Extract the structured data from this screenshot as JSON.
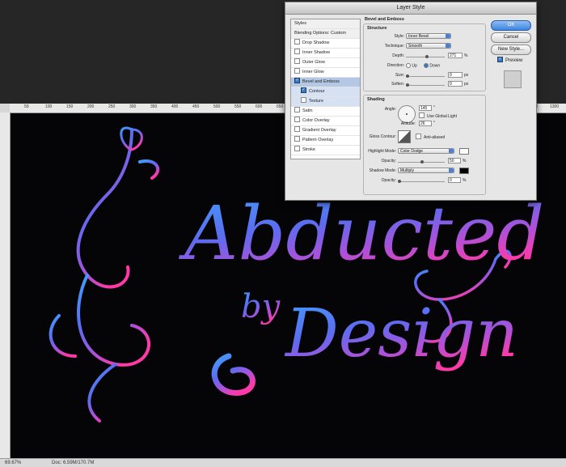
{
  "dialog": {
    "title": "Layer Style",
    "buttons": {
      "ok": "OK",
      "cancel": "Cancel",
      "new_style": "New Style...",
      "preview": "Preview"
    },
    "styles_list": [
      {
        "label": "Styles",
        "checkbox": false,
        "header": true
      },
      {
        "label": "Blending Options: Custom",
        "checkbox": false,
        "header": true
      },
      {
        "label": "Drop Shadow",
        "checkbox": true,
        "checked": false
      },
      {
        "label": "Inner Shadow",
        "checkbox": true,
        "checked": false
      },
      {
        "label": "Outer Glow",
        "checkbox": true,
        "checked": false
      },
      {
        "label": "Inner Glow",
        "checkbox": true,
        "checked": false
      },
      {
        "label": "Bevel and Emboss",
        "checkbox": true,
        "checked": true,
        "selected": true
      },
      {
        "label": "Contour",
        "checkbox": true,
        "checked": true,
        "sub": true
      },
      {
        "label": "Texture",
        "checkbox": true,
        "checked": false,
        "sub": true
      },
      {
        "label": "Satin",
        "checkbox": true,
        "checked": false
      },
      {
        "label": "Color Overlay",
        "checkbox": true,
        "checked": false
      },
      {
        "label": "Gradient Overlay",
        "checkbox": true,
        "checked": false
      },
      {
        "label": "Pattern Overlay",
        "checkbox": true,
        "checked": false
      },
      {
        "label": "Stroke",
        "checkbox": true,
        "checked": false
      }
    ],
    "bevel": {
      "section_title": "Bevel and Emboss",
      "structure_title": "Structure",
      "style_label": "Style:",
      "style_value": "Inner Bevel",
      "technique_label": "Technique:",
      "technique_value": "Smooth",
      "depth_label": "Depth:",
      "depth_value": "271",
      "depth_unit": "%",
      "direction_label": "Direction:",
      "dir_up": "Up",
      "dir_down": "Down",
      "size_label": "Size:",
      "size_value": "0",
      "size_unit": "px",
      "soften_label": "Soften:",
      "soften_value": "0",
      "soften_unit": "px"
    },
    "shading": {
      "title": "Shading",
      "angle_label": "Angle:",
      "angle_value": "145",
      "angle_unit": "°",
      "global_light": "Use Global Light",
      "altitude_label": "Altitude:",
      "altitude_value": "26",
      "altitude_unit": "°",
      "gloss_label": "Gloss Contour:",
      "anti_aliased": "Anti-aliased",
      "highlight_label": "Highlight Mode:",
      "highlight_value": "Color Dodge",
      "hl_opacity_label": "Opacity:",
      "hl_opacity_value": "50",
      "hl_opacity_unit": "%",
      "shadow_label": "Shadow Mode:",
      "shadow_value": "Multiply",
      "sh_opacity_label": "Opacity:",
      "sh_opacity_value": "0",
      "sh_opacity_unit": "%",
      "highlight_color": "#ffffff",
      "shadow_color": "#000000"
    }
  },
  "ruler": {
    "ticks": [
      "50",
      "100",
      "150",
      "200",
      "250",
      "300",
      "350",
      "400",
      "450",
      "500",
      "550",
      "600",
      "650",
      "700",
      "750",
      "800",
      "850",
      "900",
      "950",
      "1000",
      "1050",
      "1100",
      "1150",
      "1200",
      "1250",
      "1300"
    ]
  },
  "artwork": {
    "line1": "Abducted",
    "line2": "by",
    "line3": "Design"
  },
  "status": {
    "zoom": "69.67%",
    "doc": "Doc: 6.59M/170.7M"
  },
  "colors": {
    "accent_blue": "#3d86e0",
    "art_blue": "#4a7ff0",
    "art_pink": "#e040b0"
  }
}
